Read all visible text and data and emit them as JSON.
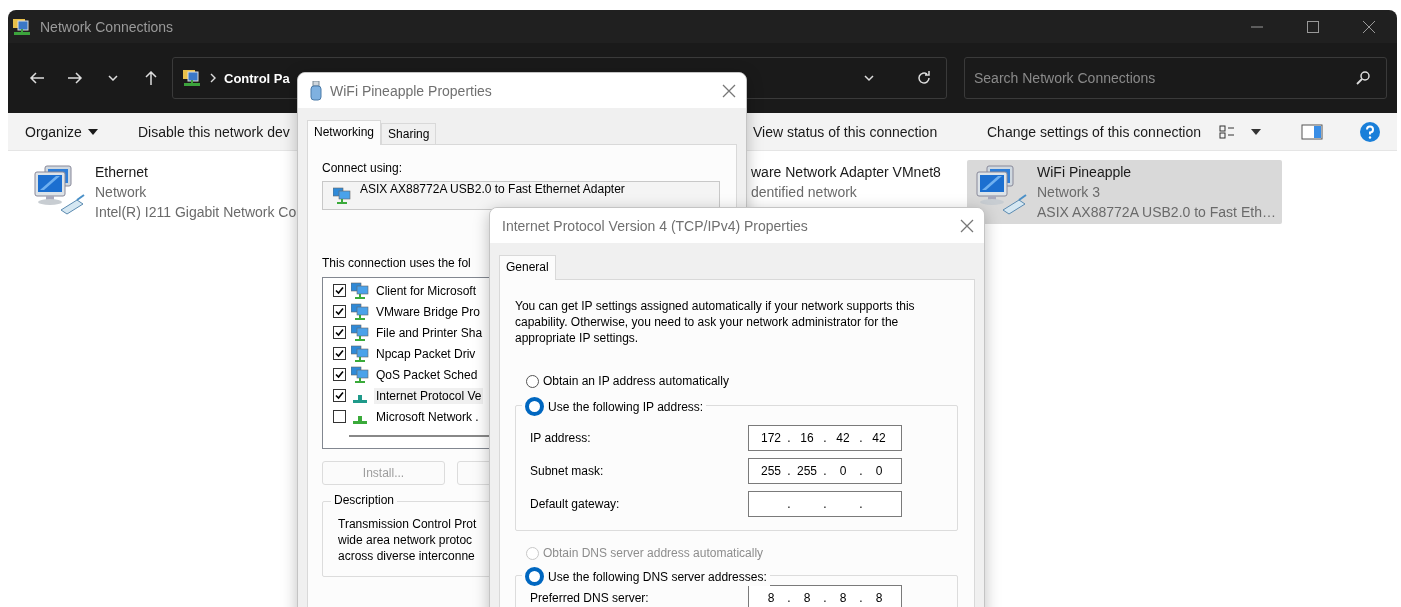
{
  "explorer": {
    "title": "Network Connections",
    "address": {
      "crumb": "Control Pa"
    },
    "search": {
      "placeholder": "Search Network Connections"
    },
    "toolbar": [
      {
        "label": "Organize",
        "kind": "menu"
      },
      {
        "label": "Disable this network dev",
        "kind": "command"
      },
      {
        "label": "View status of this connection",
        "kind": "command"
      },
      {
        "label": "Change settings of this connection",
        "kind": "command"
      }
    ],
    "items": [
      {
        "name": "Ethernet",
        "status": "Network",
        "device": "Intel(R) I211 Gigabit Network Co",
        "icon": true,
        "selected": false
      },
      {
        "name": "ware Network Adapter VMnet8",
        "status": "dentified network",
        "icon": false,
        "selected": false
      },
      {
        "name": "WiFi Pineapple",
        "status": "Network 3",
        "device": "ASIX AX88772A USB2.0 to Fast Eth…",
        "icon": true,
        "selected": true
      }
    ]
  },
  "adapter_properties": {
    "title": "WiFi Pineapple Properties",
    "tabs": [
      {
        "label": "Networking",
        "selected": true
      },
      {
        "label": "Sharing",
        "selected": false
      }
    ],
    "connect_using_label": "Connect using:",
    "adapter": "ASIX AX88772A USB2.0 to Fast Ethernet Adapter",
    "components_label": "This connection uses the fol",
    "components": [
      {
        "name": "Client for Microsoft",
        "checked": true,
        "kind": "service",
        "selected": false
      },
      {
        "name": "VMware Bridge Pro",
        "checked": true,
        "kind": "service",
        "selected": false
      },
      {
        "name": "File and Printer Sha",
        "checked": true,
        "kind": "service",
        "selected": false
      },
      {
        "name": "Npcap Packet Driv",
        "checked": true,
        "kind": "service",
        "selected": false
      },
      {
        "name": "QoS Packet Sched",
        "checked": true,
        "kind": "service",
        "selected": false
      },
      {
        "name": "Internet Protocol Ve",
        "checked": true,
        "kind": "protocol",
        "selected": true
      },
      {
        "name": "Microsoft Network .",
        "checked": false,
        "kind": "protocol",
        "selected": false
      }
    ],
    "install_button": {
      "label": "Install...",
      "disabled": true
    },
    "description": {
      "legend": "Description",
      "lines": [
        "Transmission Control Prot",
        "wide area network protoc",
        "across diverse interconne"
      ]
    }
  },
  "ipv4_properties": {
    "title": "Internet Protocol Version 4 (TCP/IPv4) Properties",
    "tabs": [
      {
        "label": "General",
        "selected": true
      }
    ],
    "intro": "You can get IP settings assigned automatically if your network supports this capability. Otherwise, you need to ask your network administrator for the appropriate IP settings.",
    "ip_separator": ".",
    "ip_mode": [
      {
        "label": "Obtain an IP address automatically",
        "selected": false,
        "disabled": false
      },
      {
        "label": "Use the following IP address:",
        "selected": true,
        "disabled": false
      }
    ],
    "ip_fields": [
      {
        "label": "IP address:",
        "octets": [
          "172",
          "16",
          "42",
          "42"
        ]
      },
      {
        "label": "Subnet mask:",
        "octets": [
          "255",
          "255",
          "0",
          "0"
        ]
      },
      {
        "label": "Default gateway:"
      }
    ],
    "dns_mode": [
      {
        "label": "Obtain DNS server address automatically",
        "selected": false,
        "disabled": true
      },
      {
        "label": "Use the following DNS server addresses:",
        "selected": true,
        "disabled": false
      }
    ],
    "dns_fields": [
      {
        "label": "Preferred DNS server:",
        "octets": [
          "8",
          "8",
          "8",
          "8"
        ]
      }
    ]
  }
}
